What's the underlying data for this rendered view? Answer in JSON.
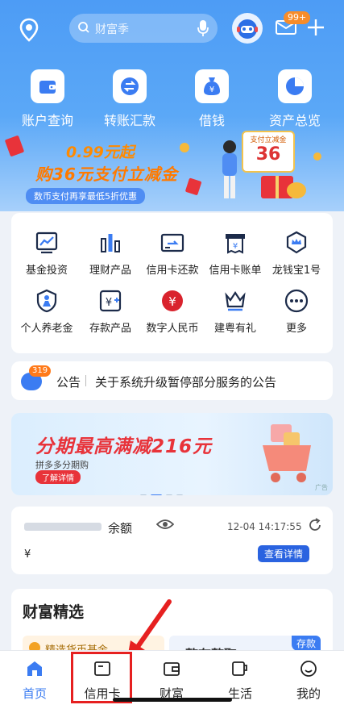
{
  "top": {
    "search_placeholder": "财富季",
    "message_badge": "99+"
  },
  "quick_actions": [
    {
      "label": "账户查询",
      "icon": "wallet-icon"
    },
    {
      "label": "转账汇款",
      "icon": "transfer-icon"
    },
    {
      "label": "借钱",
      "icon": "money-bag-icon"
    },
    {
      "label": "资产总览",
      "icon": "pie-chart-icon"
    }
  ],
  "banner": {
    "line1": "0.99元起",
    "line2": "购36元支付立减金",
    "note": "数币支付再享最低5折优惠",
    "card_title": "支付立减金",
    "card_value": "36"
  },
  "services": [
    {
      "label": "基金投资",
      "icon": "fund-chart-icon"
    },
    {
      "label": "理财产品",
      "icon": "bar-chart-icon"
    },
    {
      "label": "信用卡还款",
      "icon": "card-repay-icon"
    },
    {
      "label": "信用卡账单",
      "icon": "bill-icon"
    },
    {
      "label": "龙钱宝1号",
      "icon": "crown-shield-icon"
    },
    {
      "label": "个人养老金",
      "icon": "pension-icon"
    },
    {
      "label": "存款产品",
      "icon": "deposit-icon"
    },
    {
      "label": "数字人民币",
      "icon": "digital-rmb-icon"
    },
    {
      "label": "建粤有礼",
      "icon": "gift-crown-icon"
    },
    {
      "label": "更多",
      "icon": "more-icon"
    }
  ],
  "notice": {
    "badge": "319",
    "title": "公告",
    "text": "关于系统升级暂停部分服务的公告"
  },
  "promo": {
    "headline": "分期最高满减216元",
    "sub": "拼多多分期购",
    "button": "了解详情",
    "ad_tag": "广告"
  },
  "balance": {
    "label_suffix": "余额",
    "time": "12-04 14:17:55",
    "amount_prefix": "¥",
    "detail_button": "查看详情"
  },
  "wealth": {
    "title": "财富精选",
    "card1": "精选货币基金",
    "card2": "整存整取",
    "tag": "存款"
  },
  "tabs": [
    {
      "label": "首页",
      "icon": "home-icon",
      "active": true
    },
    {
      "label": "信用卡",
      "icon": "credit-card-icon",
      "active": false
    },
    {
      "label": "财富",
      "icon": "wallet-icon",
      "active": false
    },
    {
      "label": "生活",
      "icon": "cup-icon",
      "active": false
    },
    {
      "label": "我的",
      "icon": "smile-icon",
      "active": false
    }
  ],
  "colors": {
    "primary": "#3b7cf2",
    "highlight_box": "#e62020",
    "header_blue": "#4d9cf5"
  }
}
